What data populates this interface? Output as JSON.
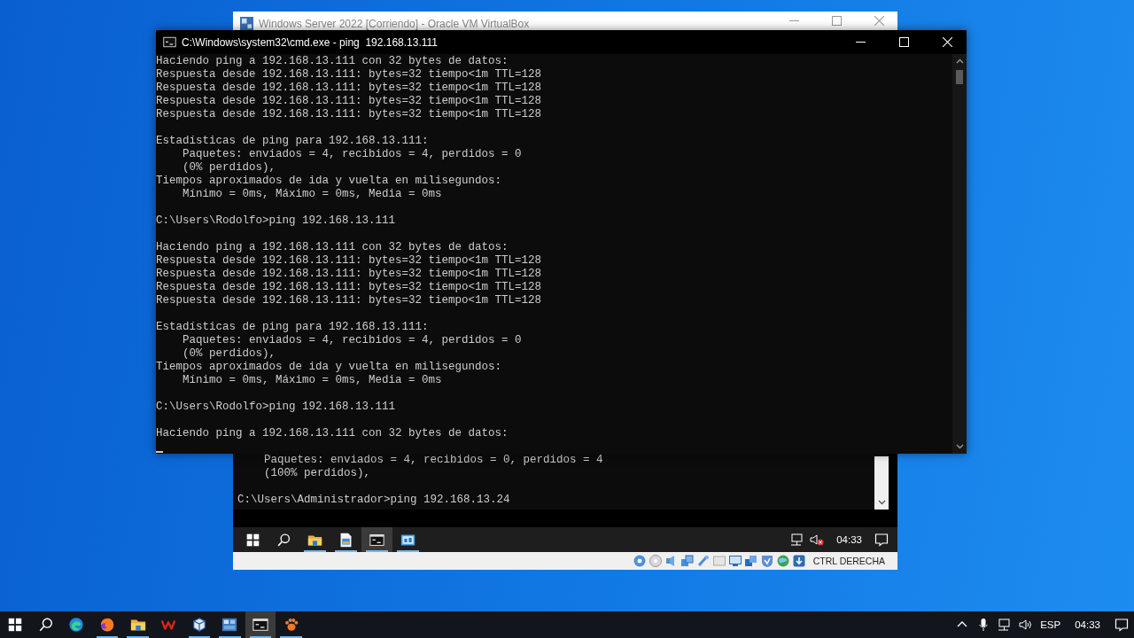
{
  "vm_window": {
    "title": "Windows Server 2022 [Corriendo] - Oracle VM VirtualBox",
    "console": {
      "blocks": [
        [
          "    Paquetes: enviados = 4, recibidos = 0, perdidos = 4",
          "    (100% perdidos),"
        ],
        [
          "C:\\Users\\Administrador>ping 192.168.13.24"
        ]
      ]
    },
    "taskbar": {
      "apps": [
        {
          "kind": "start",
          "selected": false,
          "running": false
        },
        {
          "kind": "search",
          "selected": false,
          "running": false
        },
        {
          "kind": "folder",
          "selected": false,
          "running": true
        },
        {
          "kind": "document",
          "selected": false,
          "running": true
        },
        {
          "kind": "terminal",
          "selected": true,
          "running": true
        },
        {
          "kind": "dashboard",
          "selected": false,
          "running": true
        }
      ],
      "time": "04:33"
    },
    "status_bar": {
      "host_key": "CTRL DERECHA"
    }
  },
  "cmd_window": {
    "title": "C:\\Windows\\system32\\cmd.exe - ping  192.168.13.111",
    "blocks": [
      [
        "Haciendo ping a 192.168.13.111 con 32 bytes de datos:",
        "Respuesta desde 192.168.13.111: bytes=32 tiempo<1m TTL=128",
        "Respuesta desde 192.168.13.111: bytes=32 tiempo<1m TTL=128",
        "Respuesta desde 192.168.13.111: bytes=32 tiempo<1m TTL=128",
        "Respuesta desde 192.168.13.111: bytes=32 tiempo<1m TTL=128"
      ],
      [
        "Estadísticas de ping para 192.168.13.111:",
        "    Paquetes: enviados = 4, recibidos = 4, perdidos = 0",
        "    (0% perdidos),",
        "Tiempos aproximados de ida y vuelta en milisegundos:",
        "    Mínimo = 0ms, Máximo = 0ms, Media = 0ms"
      ],
      [
        "C:\\Users\\Rodolfo>ping 192.168.13.111"
      ],
      [
        "Haciendo ping a 192.168.13.111 con 32 bytes de datos:",
        "Respuesta desde 192.168.13.111: bytes=32 tiempo<1m TTL=128",
        "Respuesta desde 192.168.13.111: bytes=32 tiempo<1m TTL=128",
        "Respuesta desde 192.168.13.111: bytes=32 tiempo<1m TTL=128",
        "Respuesta desde 192.168.13.111: bytes=32 tiempo<1m TTL=128"
      ],
      [
        "Estadísticas de ping para 192.168.13.111:",
        "    Paquetes: enviados = 4, recibidos = 4, perdidos = 0",
        "    (0% perdidos),",
        "Tiempos aproximados de ida y vuelta en milisegundos:",
        "    Mínimo = 0ms, Máximo = 0ms, Media = 0ms"
      ],
      [
        "C:\\Users\\Rodolfo>ping 192.168.13.111"
      ],
      [
        "Haciendo ping a 192.168.13.111 con 32 bytes de datos:"
      ]
    ]
  },
  "taskbar": {
    "apps": [
      {
        "kind": "start",
        "selected": false,
        "running": false
      },
      {
        "kind": "search",
        "selected": false,
        "running": false
      },
      {
        "kind": "swirl",
        "selected": false,
        "running": false
      },
      {
        "kind": "fox",
        "selected": false,
        "running": true
      },
      {
        "kind": "folder",
        "selected": false,
        "running": true
      },
      {
        "kind": "zigzag",
        "selected": false,
        "running": false
      },
      {
        "kind": "cube",
        "selected": false,
        "running": true
      },
      {
        "kind": "tile",
        "selected": false,
        "running": true
      },
      {
        "kind": "terminal",
        "selected": true,
        "running": true
      },
      {
        "kind": "paw",
        "selected": false,
        "running": true
      }
    ],
    "language": "ESP",
    "time": "04:33"
  }
}
